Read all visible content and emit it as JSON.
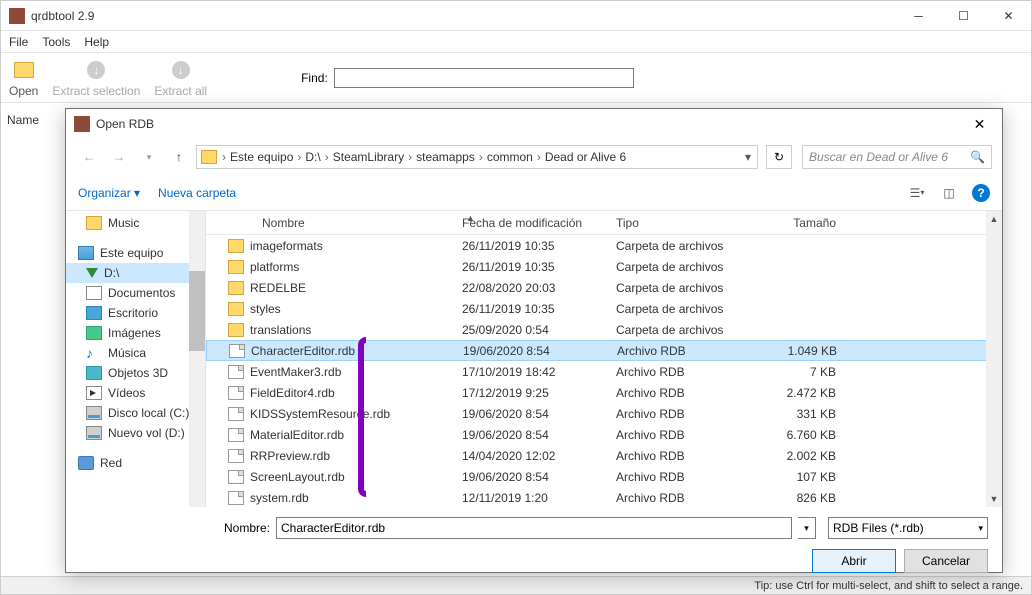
{
  "main_window": {
    "title": "qrdbtool 2.9",
    "menu": {
      "file": "File",
      "tools": "Tools",
      "help": "Help"
    },
    "toolbar": {
      "open": "Open",
      "extract_selection": "Extract selection",
      "extract_all": "Extract all",
      "find_label": "Find:"
    },
    "name_header": "Name",
    "statusbar": "Tip: use Ctrl for multi-select, and shift to select a range."
  },
  "dialog": {
    "title": "Open RDB",
    "breadcrumb": [
      "Este equipo",
      "D:\\",
      "SteamLibrary",
      "steamapps",
      "common",
      "Dead or Alive 6"
    ],
    "search_placeholder": "Buscar en Dead or Alive 6",
    "organize": "Organizar",
    "new_folder": "Nueva carpeta",
    "tree": [
      {
        "label": "Music",
        "icon": "folder",
        "lvl": 1
      },
      {
        "label": "Este equipo",
        "icon": "pc",
        "lvl": 0
      },
      {
        "label": "D:\\",
        "icon": "arrow-down",
        "lvl": 1,
        "selected": true
      },
      {
        "label": "Documentos",
        "icon": "doc",
        "lvl": 1
      },
      {
        "label": "Escritorio",
        "icon": "desk",
        "lvl": 1
      },
      {
        "label": "Imágenes",
        "icon": "img",
        "lvl": 1
      },
      {
        "label": "Música",
        "icon": "music",
        "lvl": 1
      },
      {
        "label": "Objetos 3D",
        "icon": "3d",
        "lvl": 1
      },
      {
        "label": "Vídeos",
        "icon": "video",
        "lvl": 1
      },
      {
        "label": "Disco local (C:)",
        "icon": "drive",
        "lvl": 1
      },
      {
        "label": "Nuevo vol (D:)",
        "icon": "drive",
        "lvl": 1
      },
      {
        "label": "Red",
        "icon": "net",
        "lvl": 0
      }
    ],
    "columns": {
      "name": "Nombre",
      "date": "Fecha de modificación",
      "type": "Tipo",
      "size": "Tamaño"
    },
    "files": [
      {
        "name": "imageformats",
        "date": "26/11/2019 10:35",
        "type": "Carpeta de archivos",
        "size": "",
        "kind": "folder"
      },
      {
        "name": "platforms",
        "date": "26/11/2019 10:35",
        "type": "Carpeta de archivos",
        "size": "",
        "kind": "folder"
      },
      {
        "name": "REDELBE",
        "date": "22/08/2020 20:03",
        "type": "Carpeta de archivos",
        "size": "",
        "kind": "folder"
      },
      {
        "name": "styles",
        "date": "26/11/2019 10:35",
        "type": "Carpeta de archivos",
        "size": "",
        "kind": "folder"
      },
      {
        "name": "translations",
        "date": "25/09/2020 0:54",
        "type": "Carpeta de archivos",
        "size": "",
        "kind": "folder"
      },
      {
        "name": "CharacterEditor.rdb",
        "date": "19/06/2020 8:54",
        "type": "Archivo RDB",
        "size": "1.049 KB",
        "kind": "file",
        "selected": true
      },
      {
        "name": "EventMaker3.rdb",
        "date": "17/10/2019 18:42",
        "type": "Archivo RDB",
        "size": "7 KB",
        "kind": "file"
      },
      {
        "name": "FieldEditor4.rdb",
        "date": "17/12/2019 9:25",
        "type": "Archivo RDB",
        "size": "2.472 KB",
        "kind": "file"
      },
      {
        "name": "KIDSSystemResource.rdb",
        "date": "19/06/2020 8:54",
        "type": "Archivo RDB",
        "size": "331 KB",
        "kind": "file"
      },
      {
        "name": "MaterialEditor.rdb",
        "date": "19/06/2020 8:54",
        "type": "Archivo RDB",
        "size": "6.760 KB",
        "kind": "file"
      },
      {
        "name": "RRPreview.rdb",
        "date": "14/04/2020 12:02",
        "type": "Archivo RDB",
        "size": "2.002 KB",
        "kind": "file"
      },
      {
        "name": "ScreenLayout.rdb",
        "date": "19/06/2020 8:54",
        "type": "Archivo RDB",
        "size": "107 KB",
        "kind": "file"
      },
      {
        "name": "system.rdb",
        "date": "12/11/2019 1:20",
        "type": "Archivo RDB",
        "size": "826 KB",
        "kind": "file"
      }
    ],
    "filename_label": "Nombre:",
    "filename_value": "CharacterEditor.rdb",
    "filter": "RDB Files (*.rdb)",
    "open_btn": "Abrir",
    "cancel_btn": "Cancelar"
  }
}
